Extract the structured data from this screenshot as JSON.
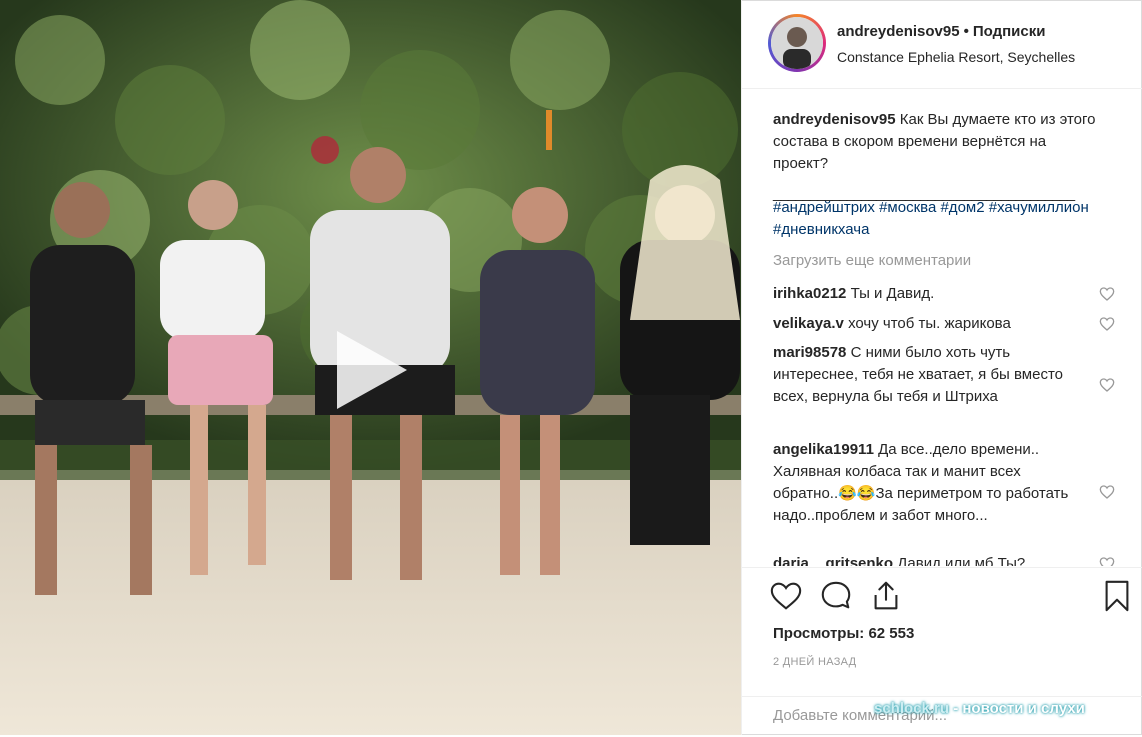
{
  "post": {
    "username": "andreydenisov95",
    "dot": "•",
    "follow_label": "Подписки",
    "location": "Constance Ephelia Resort, Seychelles"
  },
  "caption": {
    "username": "andreydenisov95",
    "text": "Как Вы думаете кто из этого состава в скором времени вернётся на проект?",
    "divider": "_________________________________________",
    "hashtags": [
      "#андрейштрих",
      "#москва",
      "#дом2",
      "#хачумиллион",
      "#дневникхача"
    ]
  },
  "load_more_label": "Загрузить еще комментарии",
  "comments": [
    {
      "username": "irihka0212",
      "text": "Ты и Давид."
    },
    {
      "username": "velikaya.v",
      "text": "хочу чтоб ты. жарикова"
    },
    {
      "username": "mari98578",
      "text": "С ними было хоть чуть интереснее, тебя не хватает, я бы вместо всех, вернула бы тебя и Штриха"
    },
    {
      "username": "angelika19911",
      "text": "Да все..дело времени.. Халявная колбаса так и манит всех обратно..😂😂За периметром то работать надо..проблем и забот много..."
    },
    {
      "username": "daria__gritsenko",
      "text": "Давид или мб Ты?"
    }
  ],
  "views": {
    "label": "Просмотры:",
    "count": "62 553"
  },
  "timestamp": "2 ДНЕЙ НАЗАД",
  "add_comment_placeholder": "Добавьте комментарий...",
  "watermark": {
    "site": "schlock.ru",
    "text": " - новости и слухи"
  },
  "icons": [
    "play-icon",
    "heart-icon",
    "comment-icon",
    "share-icon",
    "bookmark-icon"
  ],
  "colors": {
    "text": "#262626",
    "muted": "#999999",
    "hashtag": "#003569",
    "border": "#efefef"
  }
}
